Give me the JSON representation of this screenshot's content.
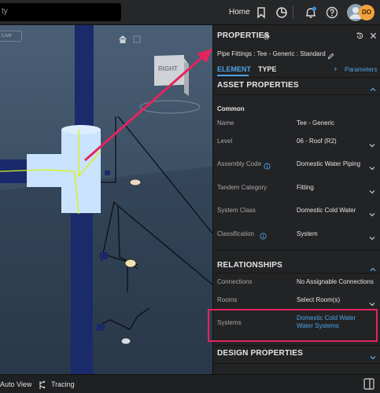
{
  "search": {
    "value": "ty"
  },
  "topbar": {
    "home_label": "Home",
    "avatar_initials": "DO",
    "avatar_color": "#f2a23a",
    "notification_color": "#2f8fe0"
  },
  "viewport": {
    "chip_label": "Live",
    "viewcube_label": "RIGHT",
    "pipe_color": "#1a2a6b",
    "fitting_color": "#c9e3ff",
    "highlight_color": "#d6f21f",
    "arrow_color": "#e5245e"
  },
  "panel": {
    "title": "PROPERTIES",
    "breadcrumb": "Pipe Fittings : Tee - Generic : Standard",
    "tabs": [
      {
        "label": "ELEMENT"
      },
      {
        "label": "TYPE"
      }
    ],
    "parameters_label": "Parameters",
    "accent_color": "#4ea3e6",
    "asset_properties": {
      "title": "ASSET PROPERTIES",
      "group_label": "Common",
      "rows": [
        {
          "label": "Name",
          "value": "Tee - Generic"
        },
        {
          "label": "Level",
          "value": "06 - Roof (R2)"
        },
        {
          "label": "Assembly Code",
          "value": "Domestic Water Piping"
        },
        {
          "label": "Tandem Category",
          "value": "Fitting"
        },
        {
          "label": "System Class",
          "value": "Domestic Cold Water"
        },
        {
          "label": "Classification",
          "value": "System"
        }
      ]
    },
    "relationships": {
      "title": "RELATIONSHIPS",
      "rows": [
        {
          "label": "Connections",
          "value": "No Assignable Connections"
        },
        {
          "label": "Rooms",
          "value": "Select Room(s)"
        },
        {
          "label": "Systems",
          "values": [
            "Domestic Cold Water",
            "Water Systems"
          ]
        }
      ],
      "highlight_color": "#e5245e"
    },
    "design_properties": {
      "title": "DESIGN PROPERTIES"
    }
  },
  "bottombar": {
    "auto_view_label": "Auto View",
    "tracing_label": "Tracing"
  }
}
